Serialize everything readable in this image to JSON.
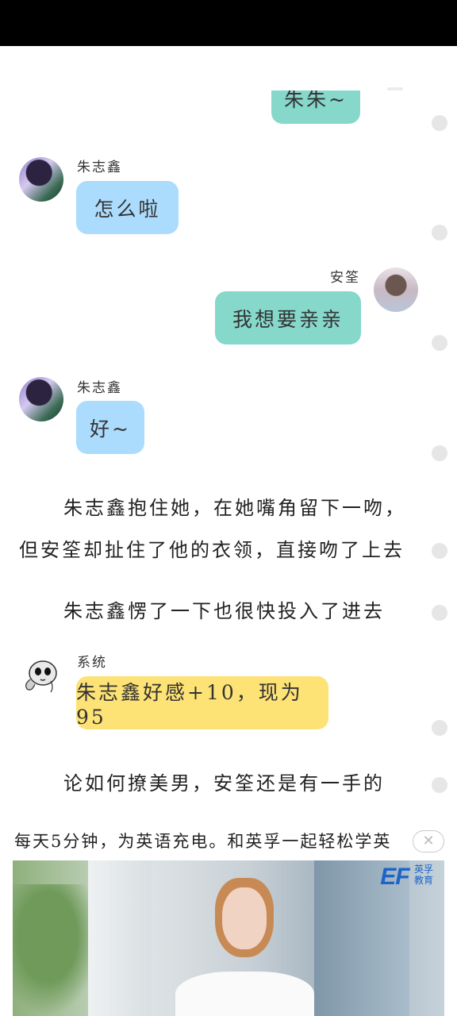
{
  "chat": {
    "messages": [
      {
        "speaker": "",
        "text": "朱朱~"
      },
      {
        "speaker": "朱志鑫",
        "text": "怎么啦"
      },
      {
        "speaker": "安筌",
        "text": "我想要亲亲"
      },
      {
        "speaker": "朱志鑫",
        "text": "好~"
      },
      {
        "speaker": "系统",
        "text": "朱志鑫好感+10，现为95"
      }
    ]
  },
  "narration": {
    "p1_line1": "朱志鑫抱住她，在她嘴角留下一吻，",
    "p1_line2": "但安筌却扯住了他的衣领，直接吻了上去",
    "p2": "朱志鑫愣了一下也很快投入了进去",
    "p3": "论如何撩美男，安筌还是有一手的"
  },
  "ad": {
    "title": "每天5分钟，为英语充电。和英孚一起轻松学英",
    "close_symbol": "✕",
    "brand_mark": "EF",
    "brand_cn_1": "英孚",
    "brand_cn_2": "教育"
  },
  "colors": {
    "zhu_bubble": "#acdcfd",
    "an_bubble": "#86d8cb",
    "system_bubble": "#fde275"
  },
  "icons": {
    "close": "close-icon",
    "dot": "page-dot-icon"
  }
}
